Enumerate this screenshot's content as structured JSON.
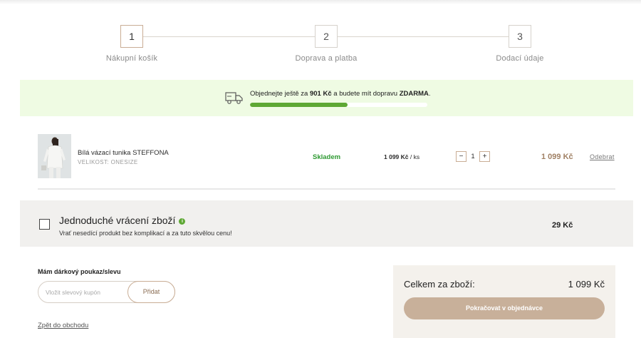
{
  "steps": [
    {
      "number": "1",
      "label": "Nákupní košík"
    },
    {
      "number": "2",
      "label": "Doprava a platba"
    },
    {
      "number": "3",
      "label": "Dodací údaje"
    }
  ],
  "shipping_banner": {
    "text_before": "Objednejte ještě za",
    "amount": "901 Kč",
    "text_middle": "a budete mít dopravu",
    "free": "ZDARMA",
    "text_end": ".",
    "progress_fraction": 0.55,
    "icon": "truck-icon",
    "progress_color": "#5ea834"
  },
  "cart_item": {
    "name": "Bílá vázací tunika STEFFONA",
    "variant": "VELIKOST: ONESIZE",
    "stock": "Skladem",
    "unit_price": "1 099 Kč",
    "unit_suffix": "/ ks",
    "qty_minus": "−",
    "quantity": "1",
    "qty_plus": "+",
    "total": "1 099 Kč",
    "remove": "Odebrat"
  },
  "easy_return": {
    "title": "Jednoduché vrácení zboží",
    "info_icon": "i",
    "description": "Vrať nesedící produkt bez komplikací a za tuto skvělou cenu!",
    "price": "29 Kč"
  },
  "coupon": {
    "label": "Mám dárkový poukaz/slevu",
    "placeholder": "Vložit slevový kupón",
    "button": "Přidat"
  },
  "back_link": "Zpět do obchodu",
  "summary": {
    "label": "Celkem za zboží:",
    "value": "1 099 Kč",
    "cta": "Pokračovat v objednávce"
  },
  "colors": {
    "accent": "#c8b09a",
    "banner_bg": "#effbe3",
    "stock_green": "#2f9a33"
  }
}
